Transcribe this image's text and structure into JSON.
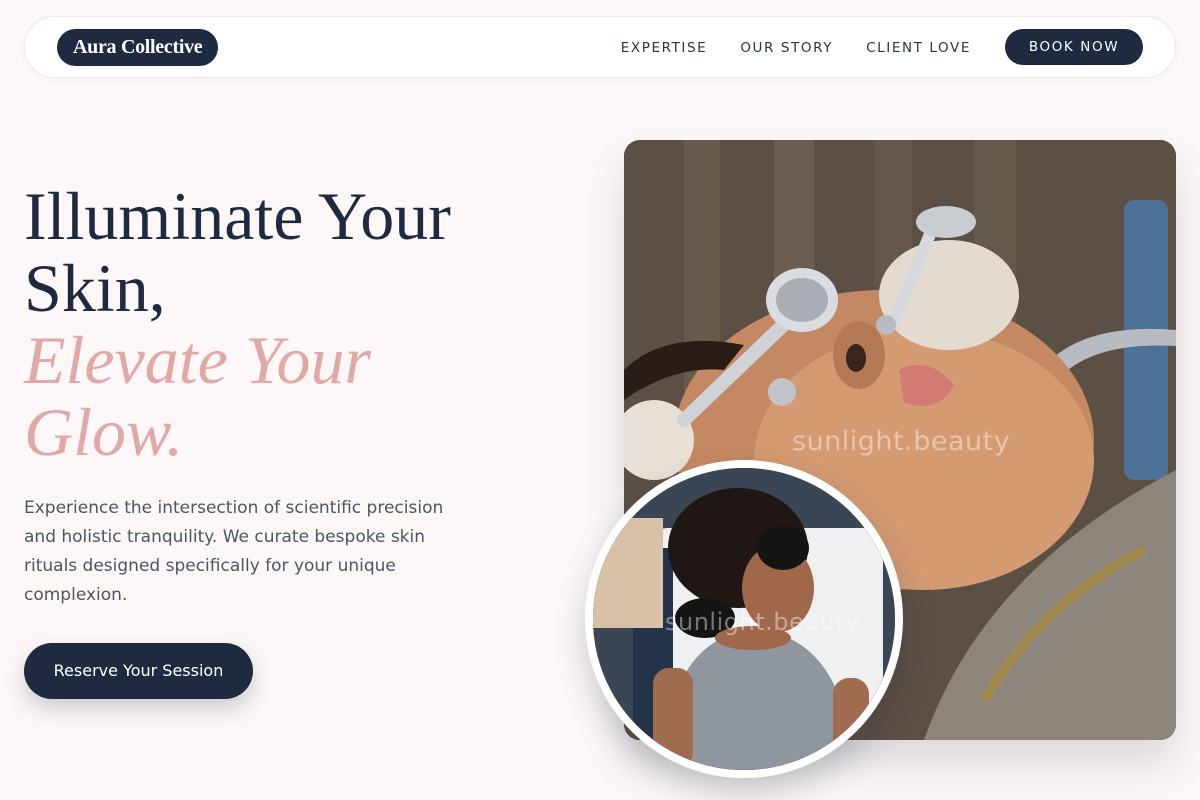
{
  "brand": {
    "name": "Aura Collective"
  },
  "nav": {
    "links": [
      "EXPERTISE",
      "OUR STORY",
      "CLIENT LOVE"
    ],
    "book_label": "BOOK NOW"
  },
  "hero": {
    "headline_line1": "Illuminate Your Skin,",
    "headline_line2": "Elevate Your Glow.",
    "subtext": "Experience the intersection of scientific precision and holistic tranquility. We curate bespoke skin rituals designed specifically for your unique complexion.",
    "cta_label": "Reserve Your Session"
  },
  "images": {
    "main_watermark": "sunlight.beauty",
    "circle_watermark": "sunlight.beauty"
  },
  "colors": {
    "navy": "#1e2a3f",
    "rose_accent": "#e0a9a7",
    "background": "#fdf8f7",
    "body_text": "#4b5567"
  }
}
